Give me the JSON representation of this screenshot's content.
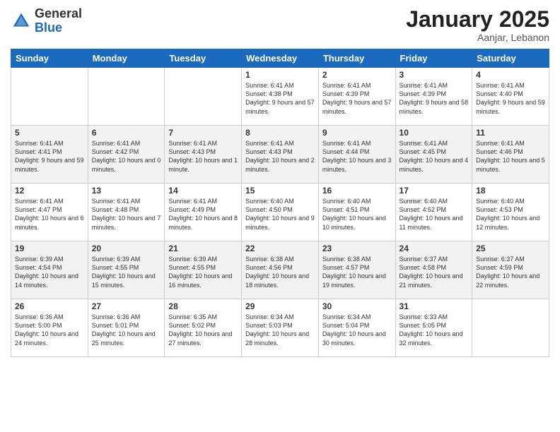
{
  "header": {
    "logo_general": "General",
    "logo_blue": "Blue",
    "month_year": "January 2025",
    "location": "Aanjar, Lebanon"
  },
  "weekdays": [
    "Sunday",
    "Monday",
    "Tuesday",
    "Wednesday",
    "Thursday",
    "Friday",
    "Saturday"
  ],
  "weeks": [
    [
      {
        "day": "",
        "content": ""
      },
      {
        "day": "",
        "content": ""
      },
      {
        "day": "",
        "content": ""
      },
      {
        "day": "1",
        "content": "Sunrise: 6:41 AM\nSunset: 4:38 PM\nDaylight: 9 hours and 57 minutes."
      },
      {
        "day": "2",
        "content": "Sunrise: 6:41 AM\nSunset: 4:39 PM\nDaylight: 9 hours and 57 minutes."
      },
      {
        "day": "3",
        "content": "Sunrise: 6:41 AM\nSunset: 4:39 PM\nDaylight: 9 hours and 58 minutes."
      },
      {
        "day": "4",
        "content": "Sunrise: 6:41 AM\nSunset: 4:40 PM\nDaylight: 9 hours and 59 minutes."
      }
    ],
    [
      {
        "day": "5",
        "content": "Sunrise: 6:41 AM\nSunset: 4:41 PM\nDaylight: 9 hours and 59 minutes."
      },
      {
        "day": "6",
        "content": "Sunrise: 6:41 AM\nSunset: 4:42 PM\nDaylight: 10 hours and 0 minutes."
      },
      {
        "day": "7",
        "content": "Sunrise: 6:41 AM\nSunset: 4:43 PM\nDaylight: 10 hours and 1 minute."
      },
      {
        "day": "8",
        "content": "Sunrise: 6:41 AM\nSunset: 4:43 PM\nDaylight: 10 hours and 2 minutes."
      },
      {
        "day": "9",
        "content": "Sunrise: 6:41 AM\nSunset: 4:44 PM\nDaylight: 10 hours and 3 minutes."
      },
      {
        "day": "10",
        "content": "Sunrise: 6:41 AM\nSunset: 4:45 PM\nDaylight: 10 hours and 4 minutes."
      },
      {
        "day": "11",
        "content": "Sunrise: 6:41 AM\nSunset: 4:46 PM\nDaylight: 10 hours and 5 minutes."
      }
    ],
    [
      {
        "day": "12",
        "content": "Sunrise: 6:41 AM\nSunset: 4:47 PM\nDaylight: 10 hours and 6 minutes."
      },
      {
        "day": "13",
        "content": "Sunrise: 6:41 AM\nSunset: 4:48 PM\nDaylight: 10 hours and 7 minutes."
      },
      {
        "day": "14",
        "content": "Sunrise: 6:41 AM\nSunset: 4:49 PM\nDaylight: 10 hours and 8 minutes."
      },
      {
        "day": "15",
        "content": "Sunrise: 6:40 AM\nSunset: 4:50 PM\nDaylight: 10 hours and 9 minutes."
      },
      {
        "day": "16",
        "content": "Sunrise: 6:40 AM\nSunset: 4:51 PM\nDaylight: 10 hours and 10 minutes."
      },
      {
        "day": "17",
        "content": "Sunrise: 6:40 AM\nSunset: 4:52 PM\nDaylight: 10 hours and 11 minutes."
      },
      {
        "day": "18",
        "content": "Sunrise: 6:40 AM\nSunset: 4:53 PM\nDaylight: 10 hours and 12 minutes."
      }
    ],
    [
      {
        "day": "19",
        "content": "Sunrise: 6:39 AM\nSunset: 4:54 PM\nDaylight: 10 hours and 14 minutes."
      },
      {
        "day": "20",
        "content": "Sunrise: 6:39 AM\nSunset: 4:55 PM\nDaylight: 10 hours and 15 minutes."
      },
      {
        "day": "21",
        "content": "Sunrise: 6:39 AM\nSunset: 4:55 PM\nDaylight: 10 hours and 16 minutes."
      },
      {
        "day": "22",
        "content": "Sunrise: 6:38 AM\nSunset: 4:56 PM\nDaylight: 10 hours and 18 minutes."
      },
      {
        "day": "23",
        "content": "Sunrise: 6:38 AM\nSunset: 4:57 PM\nDaylight: 10 hours and 19 minutes."
      },
      {
        "day": "24",
        "content": "Sunrise: 6:37 AM\nSunset: 4:58 PM\nDaylight: 10 hours and 21 minutes."
      },
      {
        "day": "25",
        "content": "Sunrise: 6:37 AM\nSunset: 4:59 PM\nDaylight: 10 hours and 22 minutes."
      }
    ],
    [
      {
        "day": "26",
        "content": "Sunrise: 6:36 AM\nSunset: 5:00 PM\nDaylight: 10 hours and 24 minutes."
      },
      {
        "day": "27",
        "content": "Sunrise: 6:36 AM\nSunset: 5:01 PM\nDaylight: 10 hours and 25 minutes."
      },
      {
        "day": "28",
        "content": "Sunrise: 6:35 AM\nSunset: 5:02 PM\nDaylight: 10 hours and 27 minutes."
      },
      {
        "day": "29",
        "content": "Sunrise: 6:34 AM\nSunset: 5:03 PM\nDaylight: 10 hours and 28 minutes."
      },
      {
        "day": "30",
        "content": "Sunrise: 6:34 AM\nSunset: 5:04 PM\nDaylight: 10 hours and 30 minutes."
      },
      {
        "day": "31",
        "content": "Sunrise: 6:33 AM\nSunset: 5:05 PM\nDaylight: 10 hours and 32 minutes."
      },
      {
        "day": "",
        "content": ""
      }
    ]
  ]
}
